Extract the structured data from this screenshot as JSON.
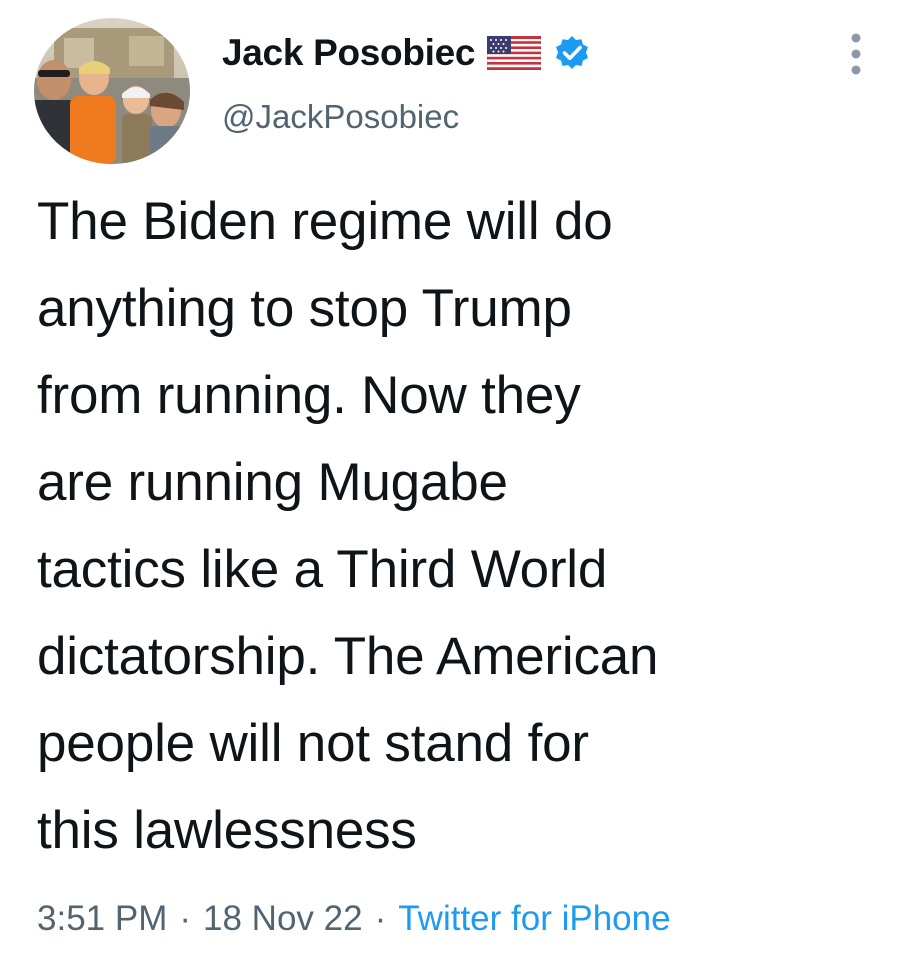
{
  "author": {
    "display_name": "Jack Posobiec",
    "handle": "@JackPosobiec",
    "avatar_icon": "profile-photo",
    "flag_icon": "us-flag-emoji",
    "verified_icon": "verified-badge-icon",
    "verified_color": "#1d9bf0"
  },
  "tweet": {
    "text": "The Biden regime will do\nanything to stop Trump\nfrom running. Now they\nare running Mugabe\ntactics like a Third World\ndictatorship. The American\npeople will not stand for\nthis lawlessness"
  },
  "meta": {
    "time": "3:51 PM",
    "separator": "·",
    "date": "18 Nov 22",
    "source": "Twitter for iPhone",
    "source_color": "#1d9bf0"
  },
  "actions": {
    "more_icon": "more-options-icon"
  }
}
